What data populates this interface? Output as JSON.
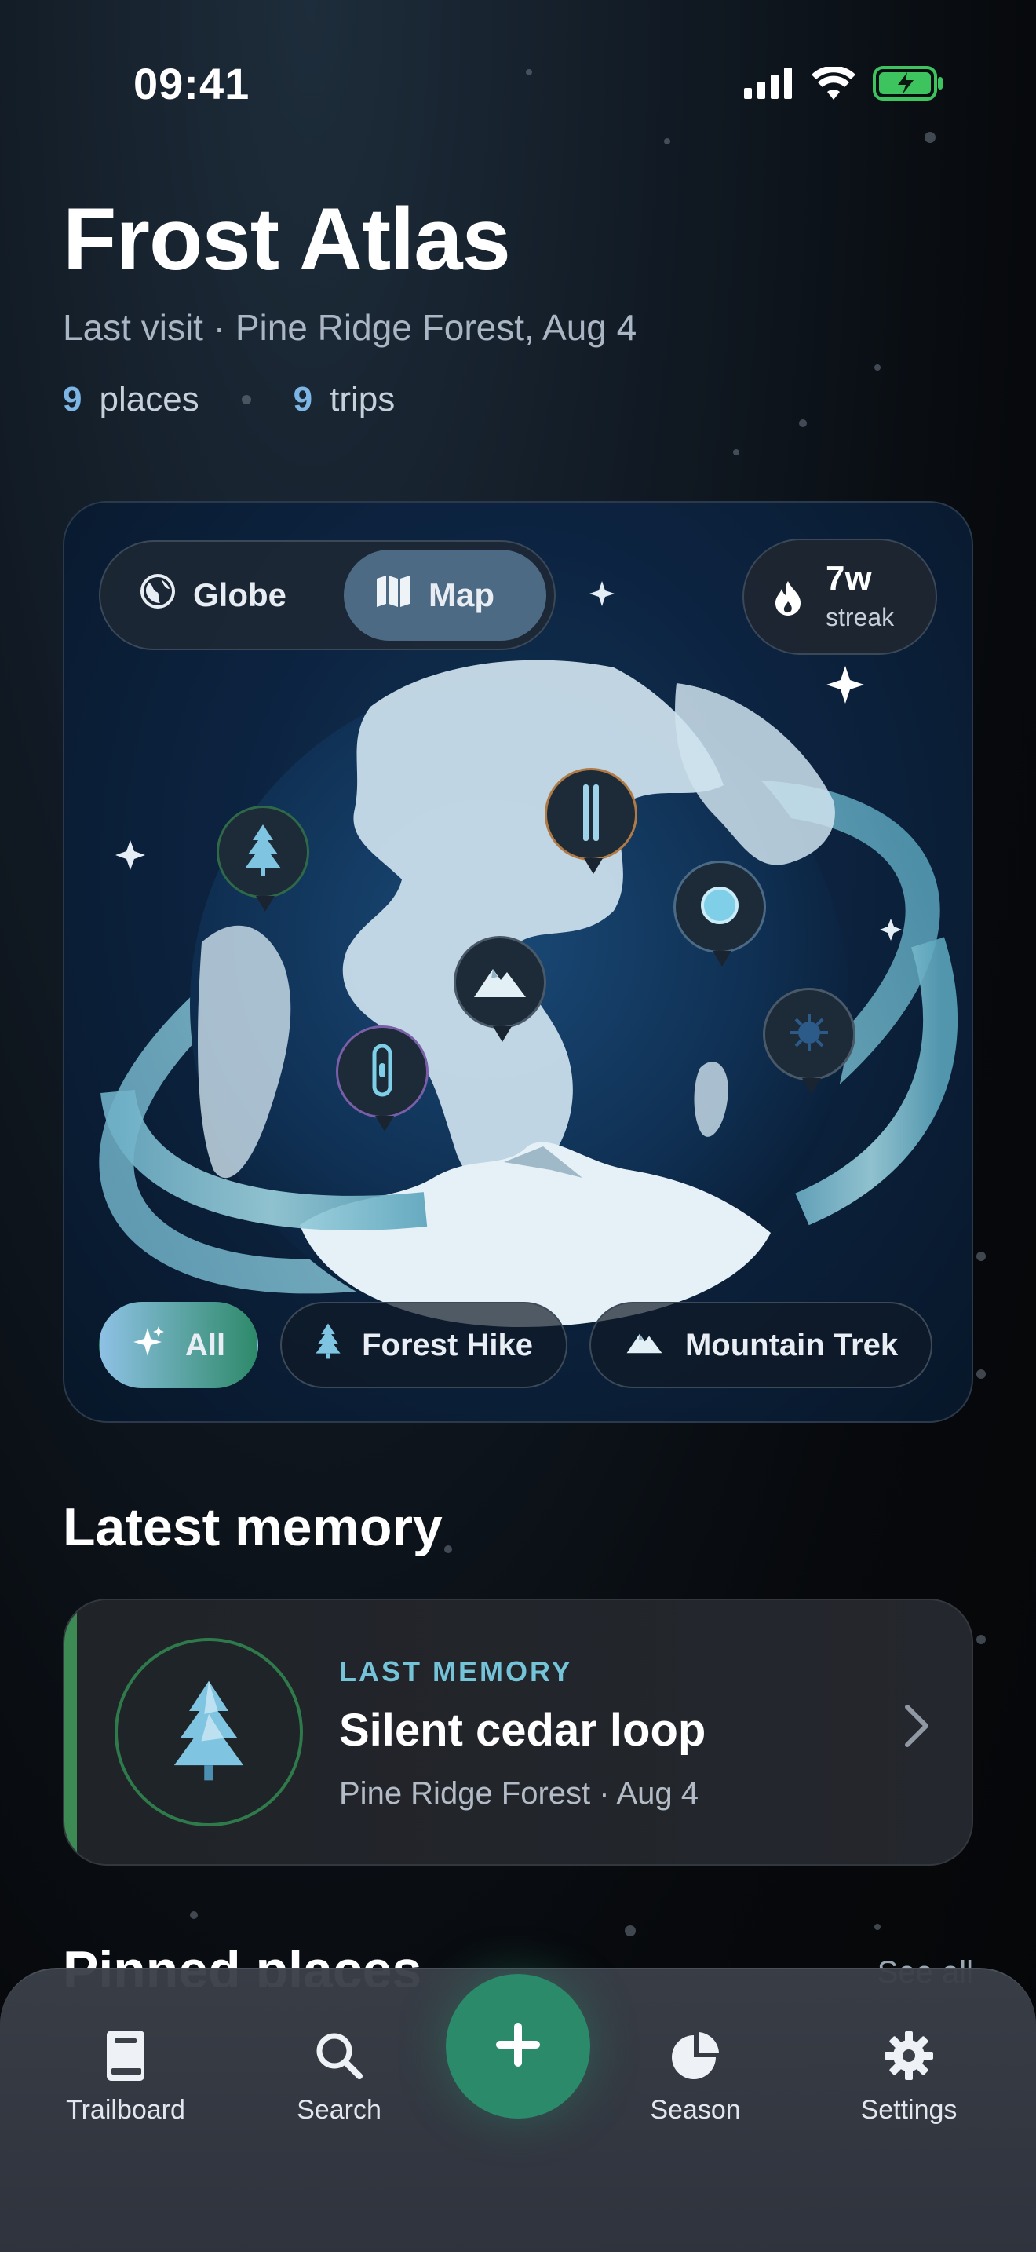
{
  "status_bar": {
    "time": "09:41"
  },
  "header": {
    "title": "Frost Atlas",
    "last_visit": "Last visit · Pine Ridge Forest, Aug 4",
    "places_count": "9",
    "places_label": "places",
    "trips_count": "9",
    "trips_label": "trips"
  },
  "globe_card": {
    "toggle": {
      "globe_label": "Globe",
      "map_label": "Map",
      "selected": "Map"
    },
    "streak": {
      "value": "7w",
      "label": "streak"
    },
    "pins": [
      {
        "name": "forest",
        "icon": "pine-tree-icon"
      },
      {
        "name": "ski",
        "icon": "skis-icon"
      },
      {
        "name": "lake",
        "icon": "lake-icon"
      },
      {
        "name": "mountain",
        "icon": "mountain-icon"
      },
      {
        "name": "cave",
        "icon": "cave-icon"
      },
      {
        "name": "trail",
        "icon": "trail-icon"
      }
    ],
    "filters": [
      {
        "label": "All",
        "icon": "sparkle-icon",
        "active": true
      },
      {
        "label": "Forest Hike",
        "icon": "pine-tree-icon",
        "active": false
      },
      {
        "label": "Mountain Trek",
        "icon": "mountain-icon",
        "active": false
      }
    ]
  },
  "latest_memory": {
    "section_title": "Latest memory",
    "kicker": "LAST MEMORY",
    "title": "Silent cedar loop",
    "subtitle": "Pine Ridge Forest · Aug 4"
  },
  "pinned_places": {
    "section_title": "Pinned places",
    "see_all": "See all"
  },
  "tab_bar": {
    "items": [
      {
        "label": "Trailboard",
        "icon": "book-icon"
      },
      {
        "label": "Search",
        "icon": "search-icon"
      },
      {
        "label": "Season",
        "icon": "pie-chart-icon"
      },
      {
        "label": "Settings",
        "icon": "gear-icon"
      }
    ],
    "fab_icon": "plus-icon"
  },
  "colors": {
    "accent_blue": "#7db6e4",
    "accent_green": "#2b8a6a",
    "memory_accent": "#3d8a55"
  }
}
